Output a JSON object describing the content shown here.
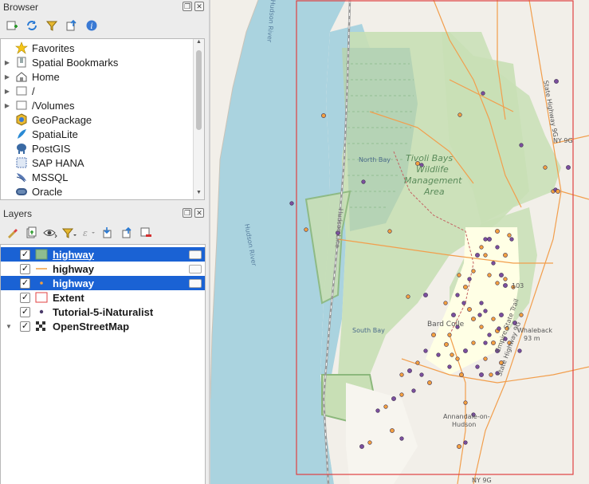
{
  "browser": {
    "title": "Browser",
    "items": [
      {
        "label": "Favorites",
        "icon": "star-icon",
        "arrow": false
      },
      {
        "label": "Spatial Bookmarks",
        "icon": "bookmark-icon",
        "arrow": true
      },
      {
        "label": "Home",
        "icon": "home-icon",
        "arrow": true
      },
      {
        "label": "/",
        "icon": "folder-icon",
        "arrow": true
      },
      {
        "label": "/Volumes",
        "icon": "folder-icon",
        "arrow": true
      },
      {
        "label": "GeoPackage",
        "icon": "geopackage-icon",
        "arrow": false
      },
      {
        "label": "SpatiaLite",
        "icon": "spatialite-icon",
        "arrow": false
      },
      {
        "label": "PostGIS",
        "icon": "postgis-icon",
        "arrow": false
      },
      {
        "label": "SAP HANA",
        "icon": "sap-hana-icon",
        "arrow": false
      },
      {
        "label": "MSSQL",
        "icon": "mssql-icon",
        "arrow": false
      },
      {
        "label": "Oracle",
        "icon": "oracle-icon",
        "arrow": false
      }
    ]
  },
  "layers": {
    "title": "Layers",
    "items": [
      {
        "label": "highway",
        "symbol": "polygon-green",
        "checked": true,
        "selected": true,
        "underlined": true
      },
      {
        "label": "highway",
        "symbol": "line-orange",
        "checked": true,
        "selected": false,
        "underlined": false
      },
      {
        "label": "highway",
        "symbol": "point-orange",
        "checked": true,
        "selected": true,
        "underlined": false
      },
      {
        "label": "Extent",
        "symbol": "polygon-outline-red",
        "checked": true,
        "selected": false,
        "underlined": false
      },
      {
        "label": "Tutorial-5-iNaturalist",
        "symbol": "point-purple",
        "checked": true,
        "selected": false,
        "underlined": false
      },
      {
        "label": "OpenStreetMap",
        "symbol": "raster",
        "checked": true,
        "selected": false,
        "underlined": false
      }
    ]
  },
  "map": {
    "labels": {
      "tivoli": "Tivoli Bays",
      "wildlife": "Wildlife",
      "management": "Management",
      "area": "Area",
      "north_bay": "North Bay",
      "south_bay": "South Bay",
      "bard": "Bard Colle",
      "whaleback": "Whaleback",
      "whaleback_elev": "93 m",
      "annandale": "Annandale-on-",
      "hudson": "Hudson",
      "ny9g": "NY 9G",
      "ny9g_bottom": "NY 9G",
      "hudson_river": "Hudson River",
      "hudson_river2": "Hudson River",
      "state_highway": "State Highway 9G",
      "state_highway2": "State Highway 9G",
      "empire_state": "Empire State Trail",
      "hudson_line": "Hudson Line",
      "rt103": "103"
    },
    "colors": {
      "water": "#aad3df",
      "land": "#f2efe9",
      "park": "#c8dfb5",
      "wetland": "#b5d3b5",
      "road": "#f29e4c",
      "extent": "#e04040",
      "point_purple": "#7b4f9e",
      "point_orange": "#f3a040",
      "selection": "#1a62d4"
    }
  }
}
